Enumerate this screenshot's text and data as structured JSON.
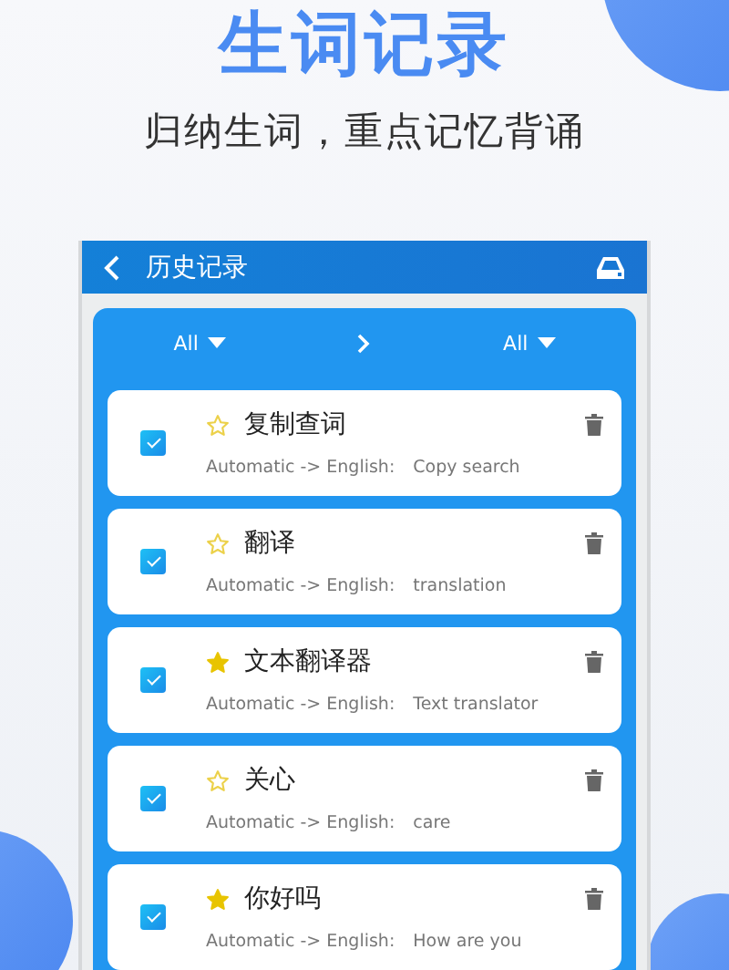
{
  "headline": "生词记录",
  "subheadline": "归纳生词，重点记忆背诵",
  "screen": {
    "title": "历史记录",
    "filter": {
      "source": "All",
      "target": "All"
    },
    "records": [
      {
        "word": "复制查词",
        "checked": true,
        "starred": false,
        "direction": "Automatic -> English:",
        "translation": "Copy search"
      },
      {
        "word": "翻译",
        "checked": true,
        "starred": false,
        "direction": "Automatic -> English:",
        "translation": "translation"
      },
      {
        "word": "文本翻译器",
        "checked": true,
        "starred": true,
        "direction": "Automatic -> English:",
        "translation": "Text translator"
      },
      {
        "word": "关心",
        "checked": true,
        "starred": false,
        "direction": "Automatic -> English:",
        "translation": "care"
      },
      {
        "word": "你好吗",
        "checked": true,
        "starred": true,
        "direction": "Automatic -> English:",
        "translation": "How are you"
      }
    ]
  }
}
